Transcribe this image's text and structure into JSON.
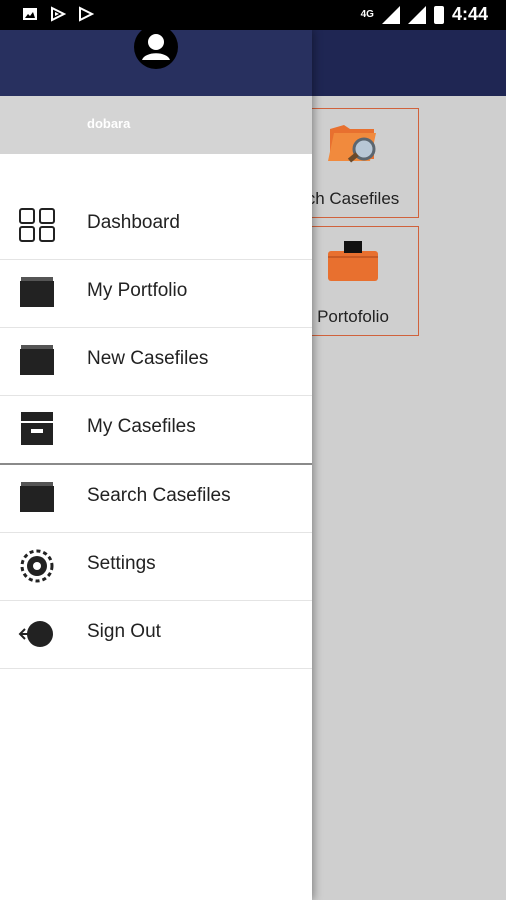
{
  "status_bar": {
    "network": "4G",
    "time": "4:44"
  },
  "background": {
    "tiles": [
      {
        "label": "ch Casefiles",
        "icon": "folder-search-icon"
      },
      {
        "label": "Portofolio",
        "icon": "briefcase-icon"
      }
    ]
  },
  "drawer": {
    "username": "dobara",
    "items": [
      {
        "label": "Dashboard",
        "icon": "dashboard-grid-icon"
      },
      {
        "label": "My Portfolio",
        "icon": "folder-icon"
      },
      {
        "label": "New Casefiles",
        "icon": "folder-icon"
      },
      {
        "label": "My Casefiles",
        "icon": "archive-box-icon"
      },
      {
        "label": "Search Casefiles",
        "icon": "folder-icon"
      },
      {
        "label": "Settings",
        "icon": "settings-gear-icon"
      },
      {
        "label": "Sign Out",
        "icon": "sign-out-icon"
      }
    ]
  },
  "colors": {
    "header": "#28305f",
    "accent": "#d0623c",
    "scrim_bg": "#cfcfcf"
  }
}
